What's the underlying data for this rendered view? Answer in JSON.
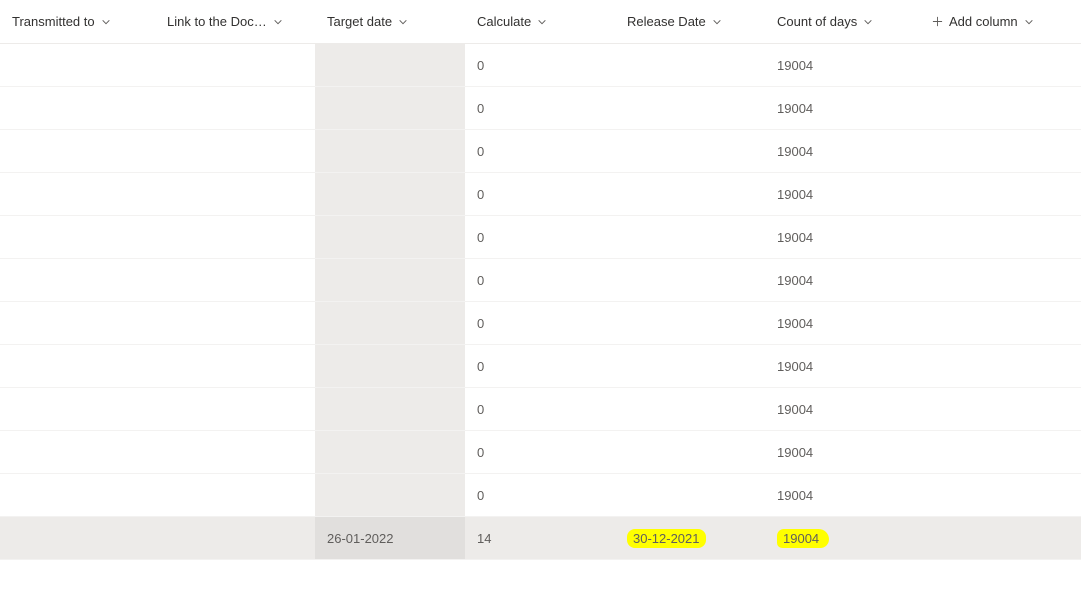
{
  "columns": {
    "transmitted": "Transmitted to",
    "link": "Link to the Doc…",
    "target": "Target date",
    "calculate": "Calculate",
    "release": "Release Date",
    "count": "Count of days",
    "add": "Add column"
  },
  "rows": [
    {
      "transmitted": "",
      "link": "",
      "target": "",
      "calculate": "0",
      "release": "",
      "count": "19004",
      "selected": false
    },
    {
      "transmitted": "",
      "link": "",
      "target": "",
      "calculate": "0",
      "release": "",
      "count": "19004",
      "selected": false
    },
    {
      "transmitted": "",
      "link": "",
      "target": "",
      "calculate": "0",
      "release": "",
      "count": "19004",
      "selected": false
    },
    {
      "transmitted": "",
      "link": "",
      "target": "",
      "calculate": "0",
      "release": "",
      "count": "19004",
      "selected": false
    },
    {
      "transmitted": "",
      "link": "",
      "target": "",
      "calculate": "0",
      "release": "",
      "count": "19004",
      "selected": false
    },
    {
      "transmitted": "",
      "link": "",
      "target": "",
      "calculate": "0",
      "release": "",
      "count": "19004",
      "selected": false
    },
    {
      "transmitted": "",
      "link": "",
      "target": "",
      "calculate": "0",
      "release": "",
      "count": "19004",
      "selected": false
    },
    {
      "transmitted": "",
      "link": "",
      "target": "",
      "calculate": "0",
      "release": "",
      "count": "19004",
      "selected": false
    },
    {
      "transmitted": "",
      "link": "",
      "target": "",
      "calculate": "0",
      "release": "",
      "count": "19004",
      "selected": false
    },
    {
      "transmitted": "",
      "link": "",
      "target": "",
      "calculate": "0",
      "release": "",
      "count": "19004",
      "selected": false
    },
    {
      "transmitted": "",
      "link": "",
      "target": "",
      "calculate": "0",
      "release": "",
      "count": "19004",
      "selected": false
    },
    {
      "transmitted": "",
      "link": "",
      "target": "26-01-2022",
      "calculate": "14",
      "release": "30-12-2021",
      "count": "19004",
      "selected": true,
      "highlightRelease": true,
      "highlightCount": true
    }
  ]
}
